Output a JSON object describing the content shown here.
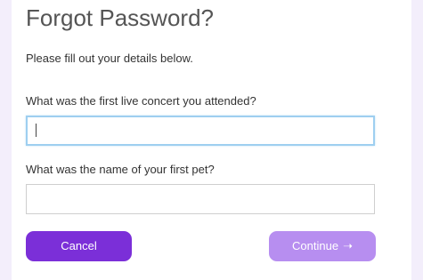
{
  "page": {
    "title": "Forgot Password?",
    "subtitle": "Please fill out your details below."
  },
  "form": {
    "question1": {
      "label": "What was the first live concert you attended?",
      "value": ""
    },
    "question2": {
      "label": "What was the name of your first pet?",
      "value": ""
    }
  },
  "buttons": {
    "cancel_label": "Cancel",
    "continue_label": "Continue",
    "continue_icon": "right-arrow-icon"
  },
  "colors": {
    "primary": "#7b2fd8",
    "primary_disabled": "#b78ef0",
    "focus_border": "#9ecff0",
    "background": "#f3eefb"
  }
}
